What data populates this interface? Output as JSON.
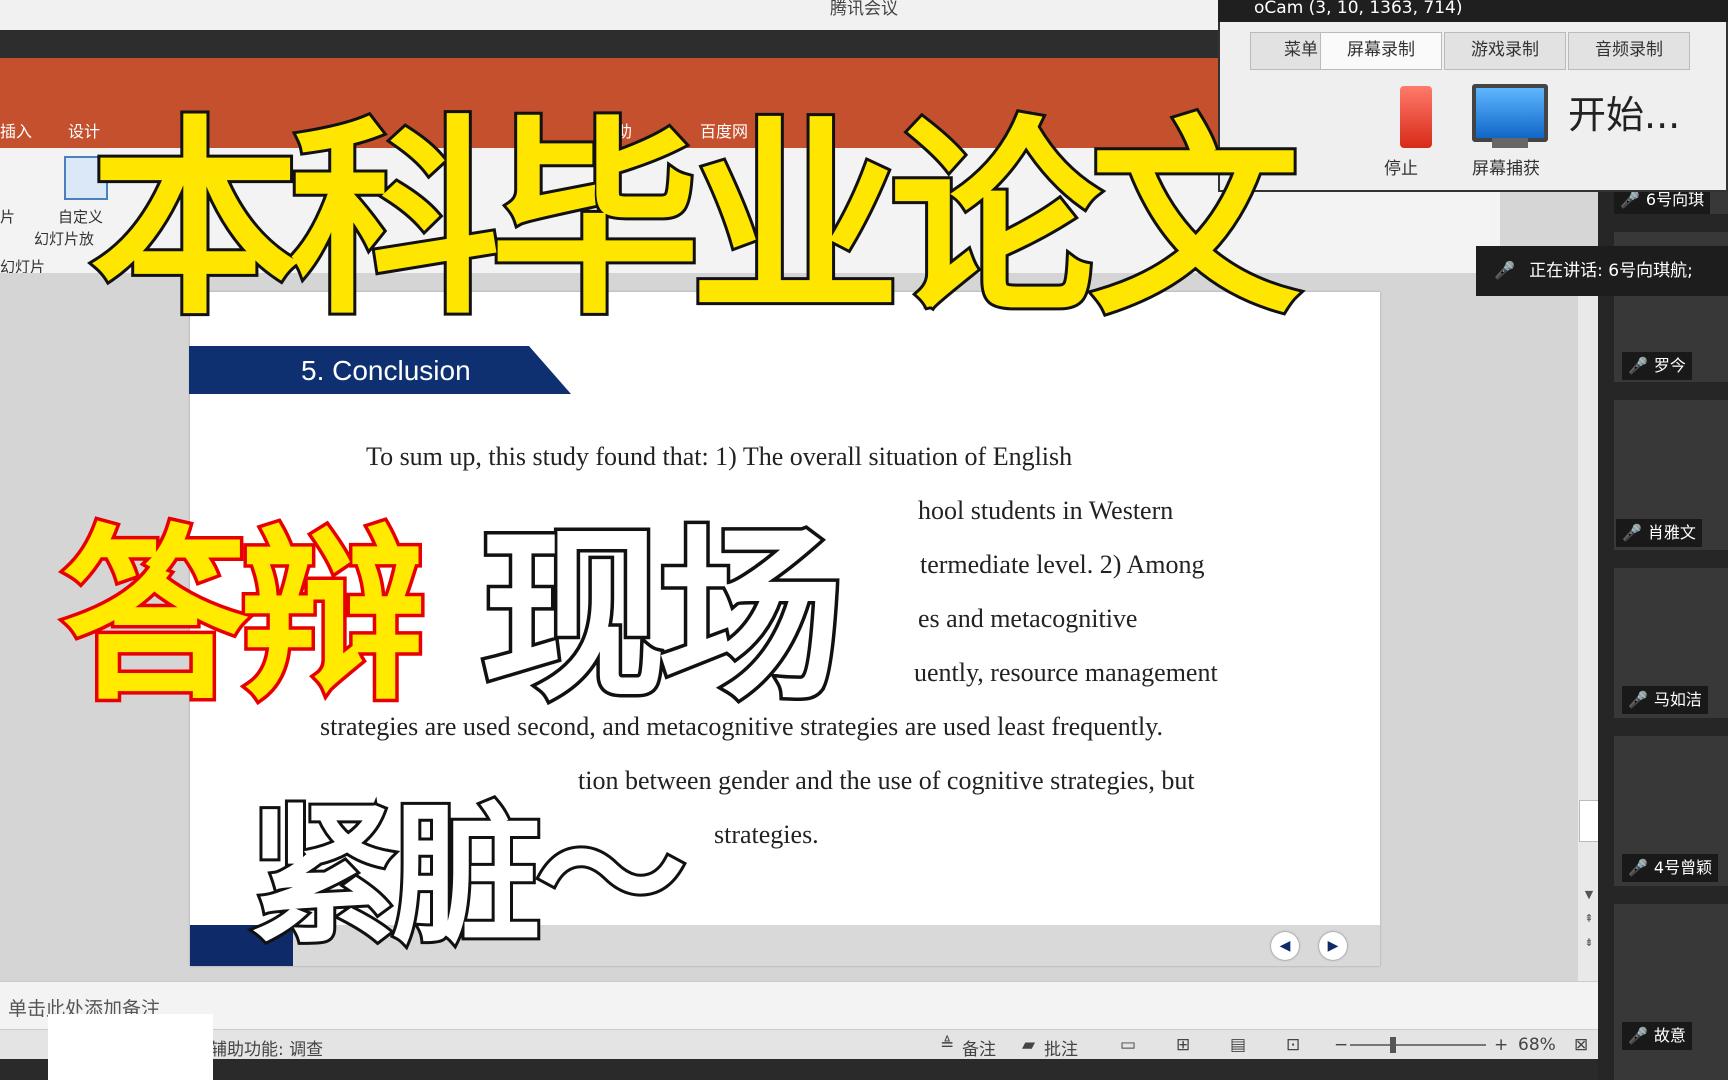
{
  "window": {
    "title": "腾讯会议"
  },
  "ribbon": {
    "tabs": [
      "插入",
      "设计",
      "帮助",
      "百度网"
    ],
    "labels": [
      "片",
      "自定义",
      "幻灯片放",
      "幻灯片"
    ]
  },
  "slide": {
    "heading": "5. Conclusion",
    "lines": [
      "To sum up, this study found that: 1) The overall situation of English",
      "hool students in Western",
      "termediate level. 2) Among",
      "es and metacognitive",
      "uently, resource management",
      "strategies are used second, and metacognitive strategies are used least frequently.",
      "tion between gender and the use of cognitive strategies, but",
      "strategies."
    ],
    "prev_icon": "arrow-left-icon",
    "next_icon": "arrow-right-icon"
  },
  "notes": {
    "placeholder": "单击此处添加备注"
  },
  "statusbar": {
    "accessibility": "辅助功能: 调查",
    "notes_label": "备注",
    "comments_label": "批注",
    "zoom": "68%"
  },
  "meeting": {
    "speaking": "正在讲话: 6号向琪航;",
    "participants": [
      "6号向琪",
      "罗今",
      "肖雅文",
      "马如洁",
      "4号曾颖",
      "故意"
    ]
  },
  "ocam": {
    "title": "oCam (3, 10, 1363, 714)",
    "tabs": [
      "菜单",
      "屏幕录制",
      "游戏录制",
      "音频录制"
    ],
    "stop_label": "停止",
    "capture_label": "屏幕捕获",
    "start_label": "开始..."
  },
  "captions": {
    "title": "本科毕业论文",
    "sub_a": "答辩",
    "sub_b": "现场",
    "sub_c": "紧脏～"
  }
}
